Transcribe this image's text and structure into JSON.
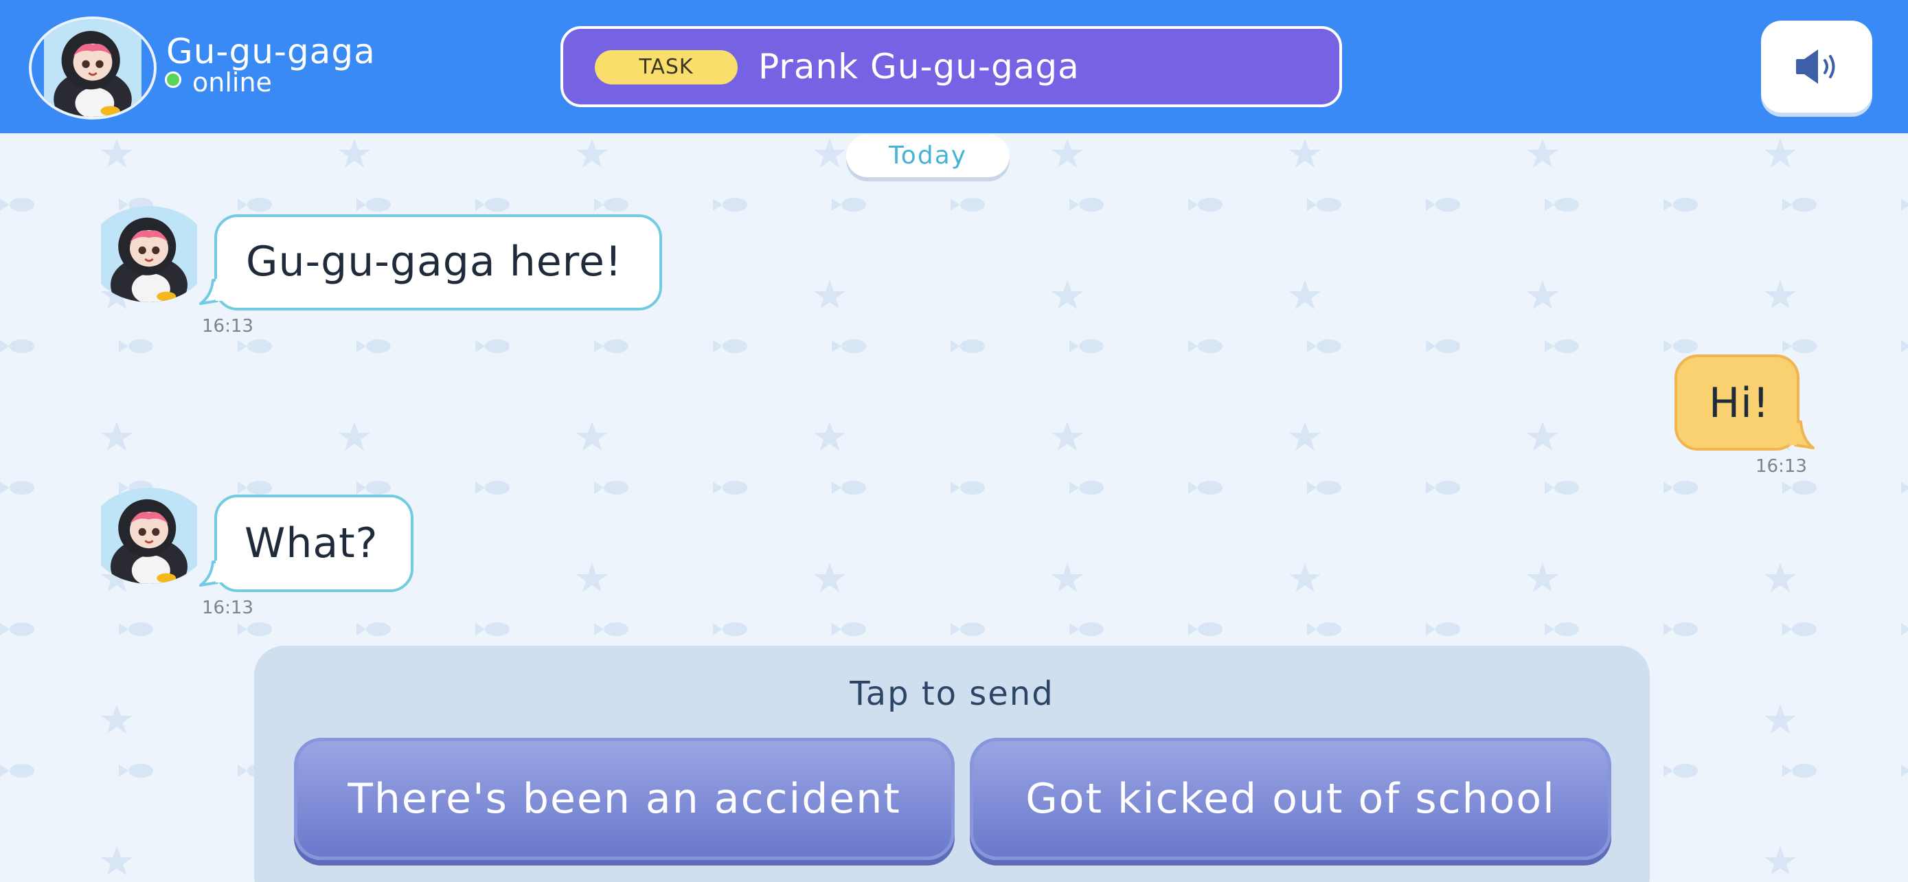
{
  "header": {
    "contact_name": "Gu-gu-gaga",
    "contact_status": "online",
    "task_badge": "TASK",
    "task_title": "Prank Gu-gu-gaga",
    "sound_icon": "speaker-icon"
  },
  "chat": {
    "day_label": "Today",
    "messages": [
      {
        "direction": "incoming",
        "text": "Gu-gu-gaga here!",
        "time": "16:13"
      },
      {
        "direction": "outgoing",
        "text": "Hi!",
        "time": "16:13"
      },
      {
        "direction": "incoming",
        "text": "What?",
        "time": "16:13"
      }
    ]
  },
  "reply_panel": {
    "prompt": "Tap to send",
    "options": [
      {
        "label": "There's been an accident"
      },
      {
        "label": "Got kicked out of school"
      }
    ]
  },
  "colors": {
    "header_bg": "#3a8af5",
    "task_banner": "#7563e3",
    "task_badge": "#f9de6b",
    "incoming_bubble_border": "#72cbe0",
    "outgoing_bubble": "#f9d170",
    "reply_option": "#7b88d6",
    "online_dot": "#5ad35a",
    "chat_bg": "#edf4fc"
  }
}
